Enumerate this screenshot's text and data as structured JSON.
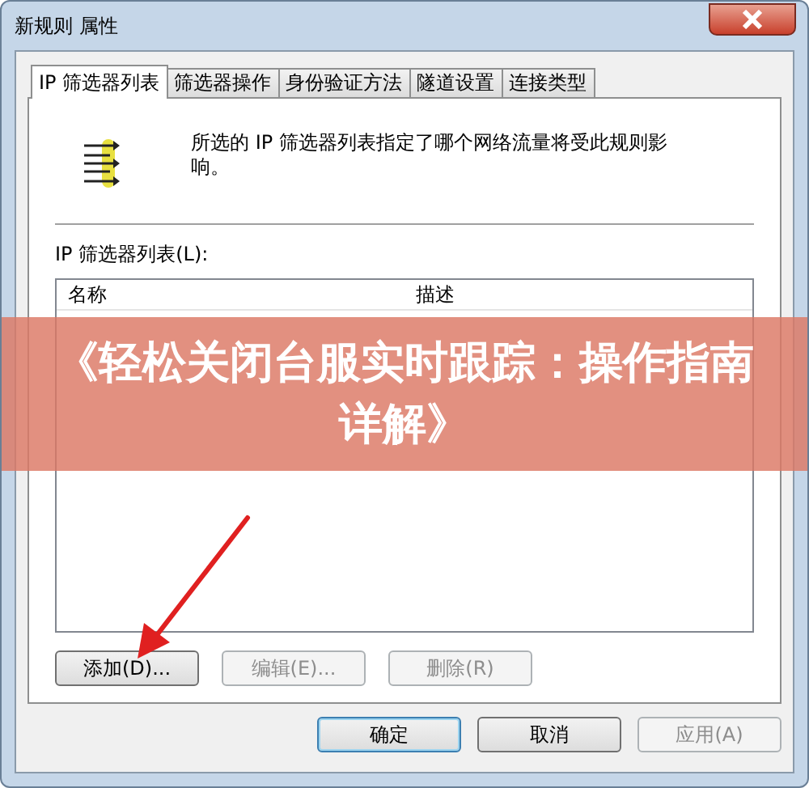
{
  "window": {
    "title": "新规则 属性"
  },
  "tabs": [
    {
      "label": "IP 筛选器列表",
      "selected": true
    },
    {
      "label": "筛选器操作",
      "selected": false
    },
    {
      "label": "身份验证方法",
      "selected": false
    },
    {
      "label": "隧道设置",
      "selected": false
    },
    {
      "label": "连接类型",
      "selected": false
    }
  ],
  "description": "所选的 IP 筛选器列表指定了哪个网络流量将受此规则影响。",
  "list": {
    "label": "IP 筛选器列表(L):",
    "columns": [
      "名称",
      "描述"
    ]
  },
  "list_buttons": [
    {
      "label": "添加(D)...",
      "disabled": false
    },
    {
      "label": "编辑(E)...",
      "disabled": true
    },
    {
      "label": "删除(R)",
      "disabled": true
    }
  ],
  "dialog_buttons": [
    {
      "label": "确定",
      "disabled": false,
      "default": true
    },
    {
      "label": "取消",
      "disabled": false,
      "default": false
    },
    {
      "label": "应用(A)",
      "disabled": true,
      "default": false
    }
  ],
  "banner": {
    "title": "《轻松关闭台服实时跟踪：操作指南详解》"
  }
}
